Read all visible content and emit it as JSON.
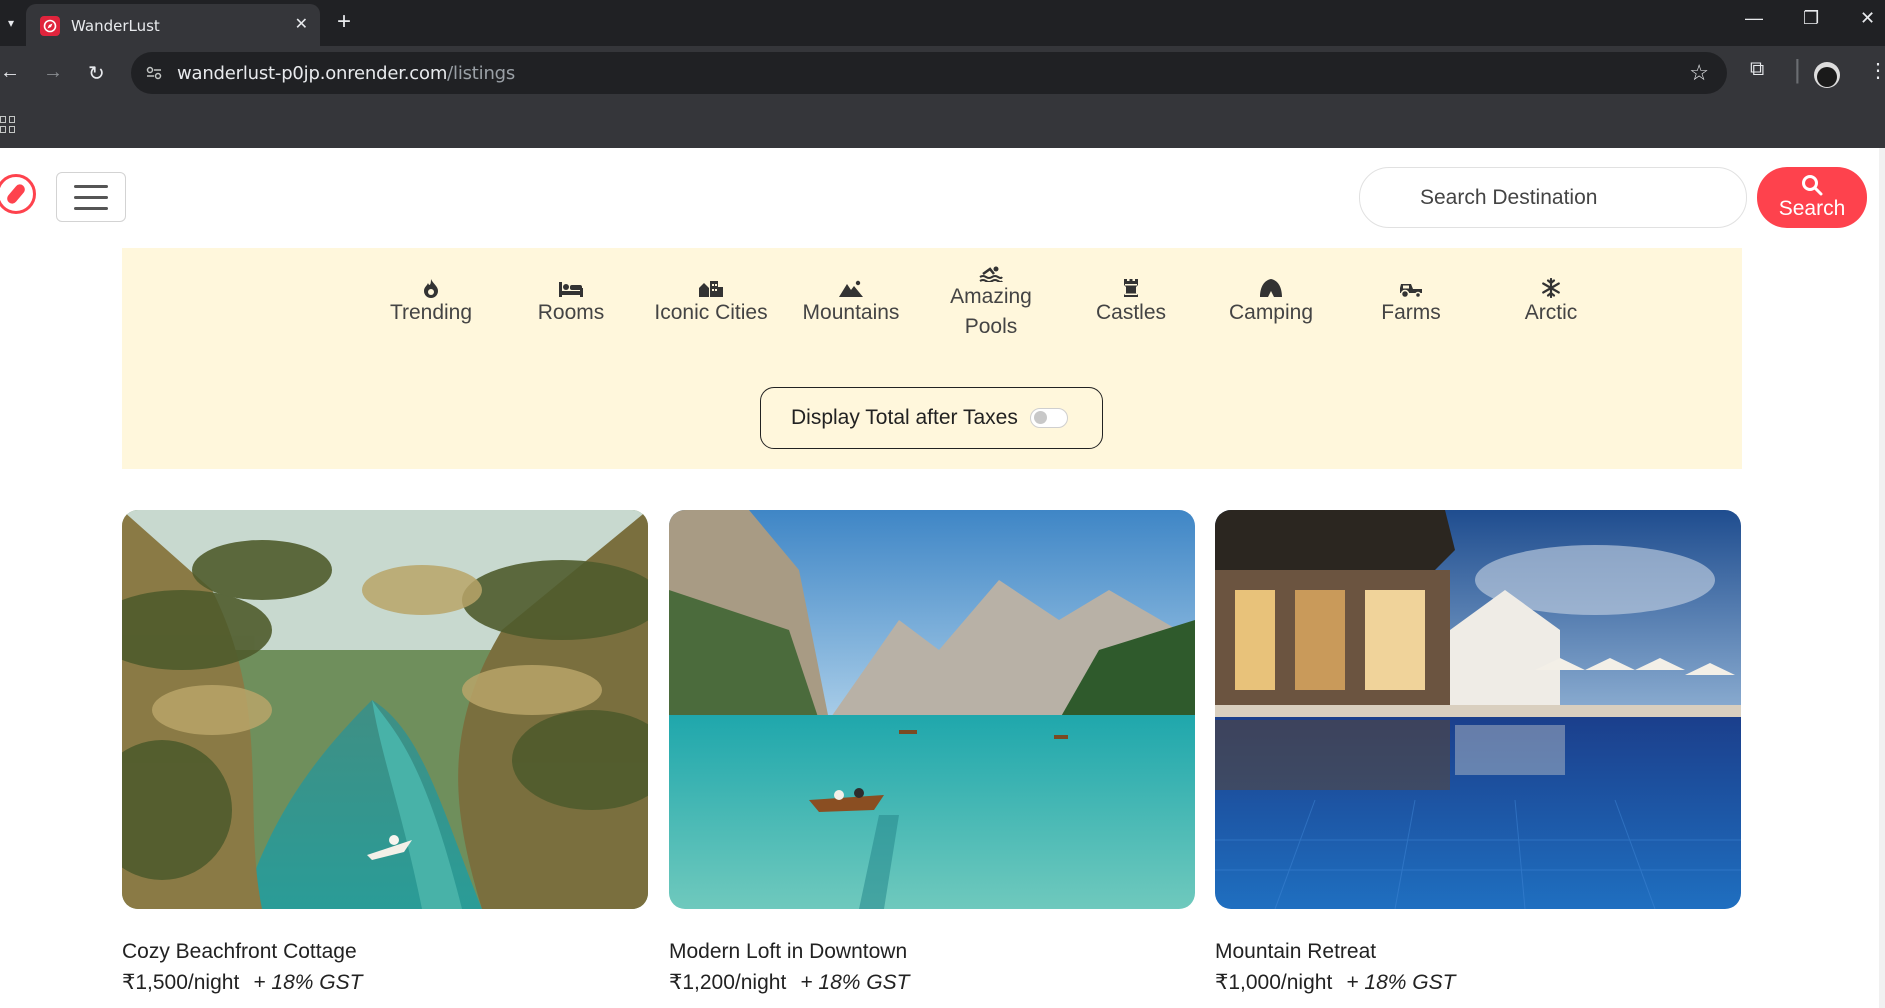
{
  "browser": {
    "tab_title": "WanderLust",
    "url_host": "wanderlust-p0jp.onrender.com",
    "url_path": "/listings"
  },
  "header": {
    "search_placeholder": "Search Destination",
    "search_button_label": "Search"
  },
  "filters": [
    {
      "label": "Trending",
      "icon": "fire-icon"
    },
    {
      "label": "Rooms",
      "icon": "bed-icon"
    },
    {
      "label": "Iconic Cities",
      "icon": "city-icon"
    },
    {
      "label": "Mountains",
      "icon": "mountain-icon"
    },
    {
      "label": "Amazing Pools",
      "icon": "pool-icon"
    },
    {
      "label": "Castles",
      "icon": "castle-icon"
    },
    {
      "label": "Camping",
      "icon": "tent-icon"
    },
    {
      "label": "Farms",
      "icon": "tractor-icon"
    },
    {
      "label": "Arctic",
      "icon": "snowflake-icon"
    }
  ],
  "tax_toggle": {
    "label": "Display Total after Taxes",
    "enabled": false
  },
  "listings": [
    {
      "title": "Cozy Beachfront Cottage",
      "price": "₹1,500/night",
      "tax_note": "+ 18% GST"
    },
    {
      "title": "Modern Loft in Downtown",
      "price": "₹1,200/night",
      "tax_note": "+ 18% GST"
    },
    {
      "title": "Mountain Retreat",
      "price": "₹1,000/night",
      "tax_note": "+ 18% GST"
    }
  ],
  "colors": {
    "brand": "#fe424d",
    "filter_bar_bg": "#fff7dc",
    "chrome_dark": "#202124",
    "chrome_mid": "#35363a"
  }
}
